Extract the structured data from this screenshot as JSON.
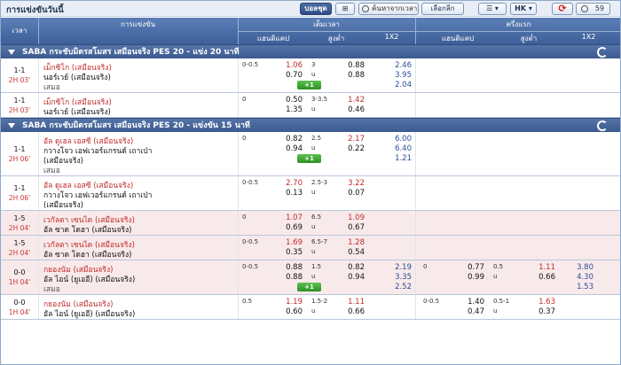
{
  "header": {
    "title": "การแข่งขันวันนี้",
    "parlay": "บอลชุด",
    "add": "⊞",
    "search": "ค้นหาจากเวลา",
    "select": "เลือกลีก",
    "sort": "☰ ▾",
    "odds": "HK ▾",
    "refresh": "⟳",
    "timer": "59"
  },
  "columns": {
    "time": "เวลา",
    "event": "การแข่งขัน",
    "ft": "เต็มเวลา",
    "fh": "ครึ่งแรก",
    "hdp": "แฮนดิแคป",
    "ou": "สูงต่ำ",
    "x12": "1X2"
  },
  "leagues": [
    {
      "name": "SABA กระชับมิตรสโมสร เสมือนจริง PES 20 - แข่ง 20 นาที",
      "matches": [
        {
          "score": "1-1",
          "live": "2H 03'",
          "home": "เม็กซิโก (เสมือนจริง)",
          "away": "นอร์เวย์ (เสมือนจริง)",
          "draw": "เสมอ",
          "hdp": "0-0.5",
          "hdpH": "1.06",
          "hdpA": "0.70",
          "ou": "3",
          "ouU": "u",
          "ouH": "0.88",
          "ouA": "0.88",
          "x1": "2.46",
          "x2": "3.95",
          "xd": "2.04",
          "plus": "+1",
          "alt": false,
          "rows": 3
        },
        {
          "score": "1-1",
          "live": "2H 03'",
          "home": "เม็กซิโก (เสมือนจริง)",
          "away": "นอร์เวย์ (เสมือนจริง)",
          "hdp": "0",
          "hdpH": "0.50",
          "hdpA": "1.35",
          "ou": "3-3.5",
          "ouU": "u",
          "ouH": "1.42",
          "ouA": "0.46",
          "alt": false,
          "rows": 2
        }
      ]
    },
    {
      "name": "SABA กระชับมิตรสโมสร เสมือนจริง PES 20 - แข่งขัน 15 นาที",
      "matches": [
        {
          "score": "1-1",
          "live": "2H 06'",
          "home": "อัล ดูเฮล เอสซี (เสมือนจริง)",
          "away": "กวางโจว เอฟเวอร์แกรนด์ เถาเป่า (เสมือนจริง)",
          "draw": "เสมอ",
          "hdp": "0",
          "hdpH": "0.82",
          "hdpA": "0.94",
          "ou": "2.5",
          "ouU": "u",
          "ouH": "2.17",
          "ouA": "0.22",
          "x1": "6.00",
          "x2": "6.40",
          "xd": "1.21",
          "plus": "+1",
          "alt": false,
          "rows": 4
        },
        {
          "score": "1-1",
          "live": "2H 06'",
          "home": "อัล ดูเฮล เอสซี (เสมือนจริง)",
          "away": "กวางโจว เอฟเวอร์แกรนด์ เถาเป่า (เสมือนจริง)",
          "hdp": "0-0.5",
          "hdpH": "2.70",
          "hdpA": "0.13",
          "ou": "2.5-3",
          "ouU": "u",
          "ouH": "3.22",
          "ouA": "0.07",
          "alt": false,
          "rows": 3
        },
        {
          "score": "1-5",
          "live": "2H 04'",
          "home": "เวกัลตา เซนได (เสมือนจริง)",
          "away": "อัล ซาด โดฮา (เสมือนจริง)",
          "hdp": "0",
          "hdpH": "1.07",
          "hdpA": "0.69",
          "ou": "6.5",
          "ouU": "u",
          "ouH": "1.09",
          "ouA": "0.67",
          "alt": true,
          "rows": 2
        },
        {
          "score": "1-5",
          "live": "2H 04'",
          "home": "เวกัลตา เซนได (เสมือนจริง)",
          "away": "อัล ซาด โดฮา (เสมือนจริง)",
          "hdp": "0-0.5",
          "hdpH": "1.69",
          "hdpA": "0.35",
          "ou": "6.5-7",
          "ouU": "u",
          "ouH": "1.28",
          "ouA": "0.54",
          "alt": true,
          "rows": 2
        },
        {
          "score": "0-0",
          "live": "1H 04'",
          "home": "กยองนัม (เสมือนจริง)",
          "away": "อัล ไอน์ (ยูเออี) (เสมือนจริง)",
          "draw": "เสมอ",
          "hdp": "0-0.5",
          "hdpH": "0.88",
          "hdpA": "0.88",
          "ou": "1.5",
          "ouU": "u",
          "ouH": "0.82",
          "ouA": "0.94",
          "x1": "2.19",
          "x2": "3.35",
          "xd": "2.52",
          "plus": "+1",
          "fh": {
            "hdp": "0",
            "hdpH": "0.77",
            "hdpA": "0.99",
            "ou": "0.5",
            "ouU": "u",
            "ouH": "1.11",
            "ouA": "0.66",
            "x1": "3.80",
            "x2": "4.30",
            "xd": "1.53"
          },
          "alt": true,
          "rows": 3
        },
        {
          "score": "0-0",
          "live": "1H 04'",
          "home": "กยองนัม (เสมือนจริง)",
          "away": "อัล ไอน์ (ยูเออี) (เสมือนจริง)",
          "hdp": "0.5",
          "hdpH": "1.19",
          "hdpA": "0.60",
          "ou": "1.5-2",
          "ouU": "u",
          "ouH": "1.11",
          "ouA": "0.66",
          "fh": {
            "hdp": "0-0.5",
            "hdpH": "1.40",
            "hdpA": "0.47",
            "ou": "0.5-1",
            "ouU": "u",
            "ouH": "1.63",
            "ouA": "0.37"
          },
          "alt": false,
          "rows": 2
        }
      ]
    }
  ],
  "colors": {
    "accent": "#3e5f98",
    "fav": "#c12a2a",
    "altRow": "#f8eaea"
  }
}
